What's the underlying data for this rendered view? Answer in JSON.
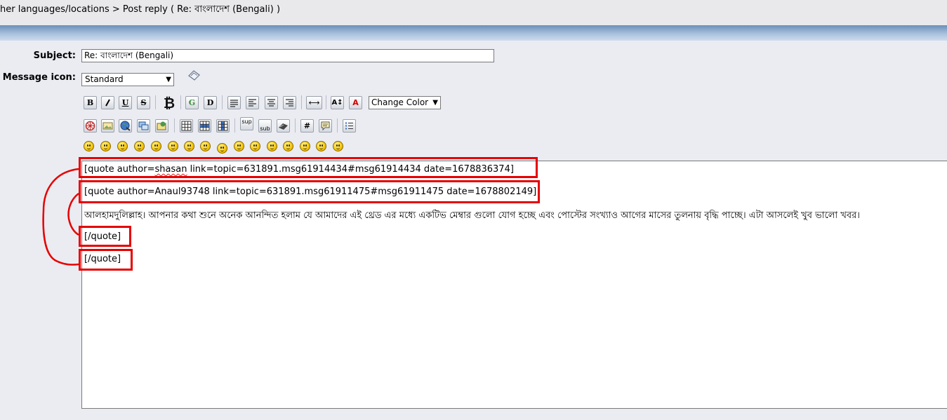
{
  "breadcrumb": {
    "text": "her languages/locations > Post reply ( Re: বাংলাদেশ (Bengali) )"
  },
  "form": {
    "subject_label": "Subject:",
    "subject_value": "Re: বাংলাদেশ (Bengali)",
    "icon_label": "Message icon:",
    "icon_selected": "Standard"
  },
  "toolbar": {
    "bold": "B",
    "italic": "I",
    "underline": "U",
    "strike": "S",
    "glow": "G",
    "shadow": "D",
    "hr": "⟷",
    "size": "A↕",
    "color_letter": "A",
    "color_select": "Change Color",
    "sup": "sup",
    "sub": "sub",
    "hash": "#"
  },
  "editor": {
    "line1_prefix": "[quote author=",
    "line1_user": "shasan",
    "line1_suffix": " link=topic=631891.msg61914434#msg61914434 date=1678836374]",
    "line2": "[quote author=Anaul93748 link=topic=631891.msg61911475#msg61911475 date=1678802149]",
    "line3": "আলহামদুলিল্লাহ। আপনার কথা শুনে অনেক আনন্দিত হলাম যে আমাদের এই থ্রেড এর মধ্যে একটিভ মেম্বার গুলো যোগ হচ্ছে এবং পোস্টের সংখ্যাও আগের মাসের তুলনায় বৃদ্ধি পাচ্ছে। এটা আসলেই খুব ভালো খবর।",
    "line4": "[/quote]",
    "line5": "[/quote]"
  },
  "colors": {
    "annotation": "#e60000",
    "header_gradient_top": "#6b8fb8",
    "panel": "#eaecf2"
  }
}
